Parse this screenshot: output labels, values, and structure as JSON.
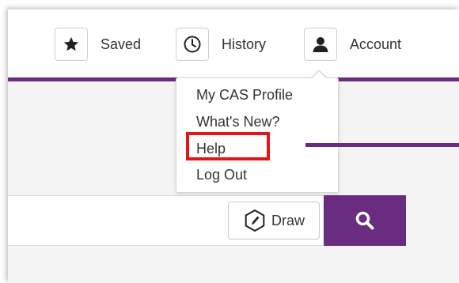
{
  "header": {
    "nav": [
      {
        "label": "Saved",
        "icon": "star-icon"
      },
      {
        "label": "History",
        "icon": "clock-icon"
      },
      {
        "label": "Account",
        "icon": "user-icon"
      }
    ]
  },
  "account_menu": {
    "items": [
      {
        "label": "My CAS Profile"
      },
      {
        "label": "What's New?"
      },
      {
        "label": "Help",
        "highlighted": true
      },
      {
        "label": "Log Out"
      }
    ]
  },
  "search": {
    "draw_label": "Draw",
    "draw_icon": "pencil-hexagon-icon",
    "search_icon": "search-icon"
  },
  "colors": {
    "brand_purple": "#6a2c7e",
    "highlight_red": "#e4141b"
  }
}
